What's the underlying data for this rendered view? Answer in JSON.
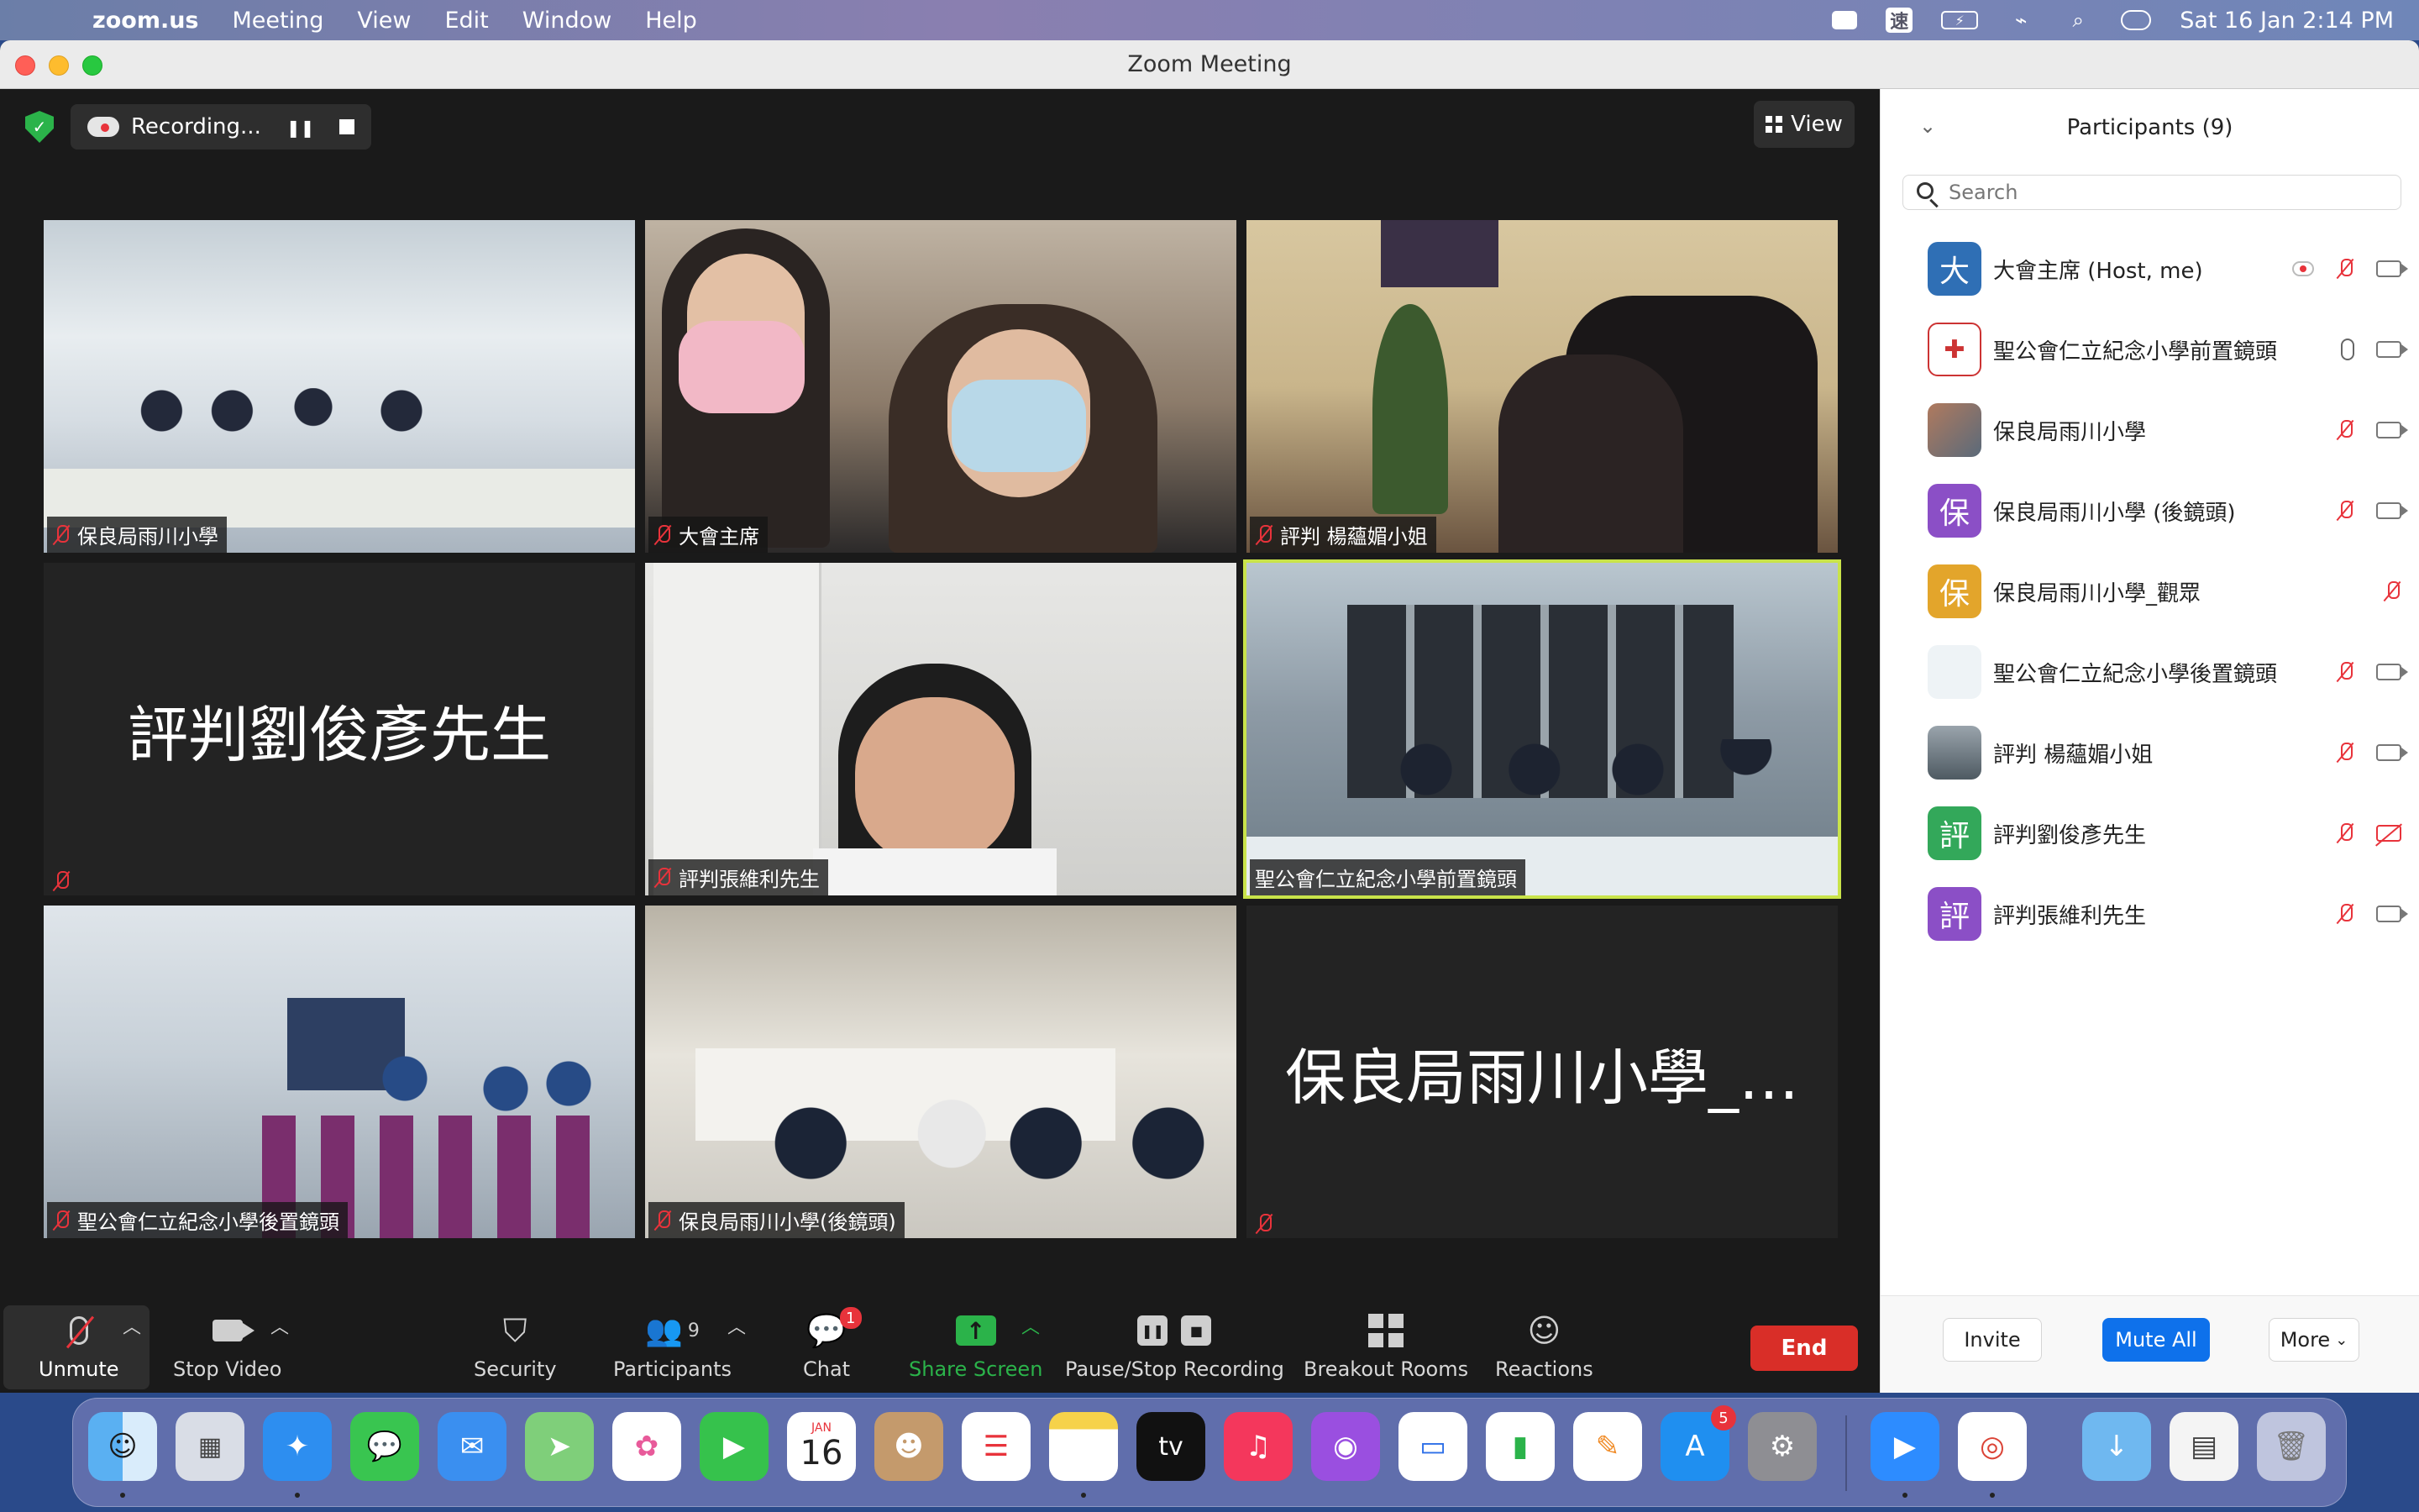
{
  "menubar": {
    "app_name": "zoom.us",
    "items": [
      "Meeting",
      "View",
      "Edit",
      "Window",
      "Help"
    ],
    "ime_glyph": "速",
    "datetime": "Sat 16 Jan  2:14 PM"
  },
  "window": {
    "title": "Zoom Meeting"
  },
  "meeting": {
    "recording_label": "Recording...",
    "view_label": "View",
    "tiles": [
      {
        "name": "保良局雨川小學",
        "scene": "classroom",
        "muted": true
      },
      {
        "name": "大會主席",
        "scene": "women",
        "muted": true
      },
      {
        "name": "評判 楊蘊媚小姐",
        "scene": "office",
        "muted": true
      },
      {
        "name": "",
        "big_name": "評判劉俊彥先生",
        "muted": true
      },
      {
        "name": "評判張維利先生",
        "scene": "man",
        "muted": true
      },
      {
        "name": "聖公會仁立紀念小學前置鏡頭",
        "scene": "lab",
        "muted": false,
        "active": true
      },
      {
        "name": "聖公會仁立紀念小學後置鏡頭",
        "scene": "hall",
        "muted": true
      },
      {
        "name": "保良局雨川小學(後鏡頭)",
        "scene": "room2",
        "muted": true
      },
      {
        "name": "",
        "big_name": "保良局雨川小學_…",
        "muted": true
      }
    ]
  },
  "toolbar": {
    "unmute": "Unmute",
    "stop_video": "Stop Video",
    "security": "Security",
    "participants": "Participants",
    "participants_count": "9",
    "chat": "Chat",
    "chat_badge": "1",
    "share_screen": "Share Screen",
    "pause_stop_recording": "Pause/Stop Recording",
    "breakout_rooms": "Breakout Rooms",
    "reactions": "Reactions",
    "end": "End"
  },
  "panel": {
    "title": "Participants (9)",
    "search_placeholder": "Search",
    "participants": [
      {
        "name": "大會主席 (Host, me)",
        "avatar": "大",
        "avatar_color": "#2f6fb5",
        "mic": "off",
        "video": "on",
        "recording": true
      },
      {
        "name": "聖公會仁立紀念小學前置鏡頭",
        "avatar": "",
        "avatar_color": "#ffffff",
        "avatar_kind": "crest",
        "mic": "on",
        "video": "on"
      },
      {
        "name": "保良局雨川小學",
        "avatar": "",
        "avatar_color": "#8a6a5a",
        "avatar_kind": "photo",
        "mic": "off",
        "video": "on"
      },
      {
        "name": "保良局雨川小學 (後鏡頭)",
        "avatar": "保",
        "avatar_color": "#8b4fc6",
        "mic": "off",
        "video": "on"
      },
      {
        "name": "保良局雨川小學_觀眾",
        "avatar": "保",
        "avatar_color": "#e3a52b",
        "mic": "off",
        "video": "none"
      },
      {
        "name": "聖公會仁立紀念小學後置鏡頭",
        "avatar": "",
        "avatar_color": "#eef3f6",
        "avatar_kind": "blank",
        "mic": "off",
        "video": "on"
      },
      {
        "name": "評判 楊蘊媚小姐",
        "avatar": "",
        "avatar_color": "#6c7780",
        "avatar_kind": "photo",
        "mic": "off",
        "video": "on"
      },
      {
        "name": "評判劉俊彥先生",
        "avatar": "評",
        "avatar_color": "#33a85a",
        "mic": "off",
        "video": "off"
      },
      {
        "name": "評判張維利先生",
        "avatar": "評",
        "avatar_color": "#8b4fc6",
        "mic": "off",
        "video": "on"
      }
    ],
    "invite": "Invite",
    "mute_all": "Mute All",
    "more": "More"
  },
  "dock": {
    "calendar_month": "JAN",
    "calendar_day": "16",
    "appstore_badge": "5",
    "apps": [
      "finder",
      "launchpad",
      "safari",
      "messages",
      "mail",
      "maps",
      "photos",
      "facetime",
      "calendar",
      "contacts",
      "reminders",
      "notes",
      "tv",
      "music",
      "podcasts",
      "keynote",
      "numbers",
      "pages",
      "app-store",
      "system-preferences",
      "zoom",
      "chrome",
      "downloads",
      "preview",
      "trash"
    ]
  }
}
